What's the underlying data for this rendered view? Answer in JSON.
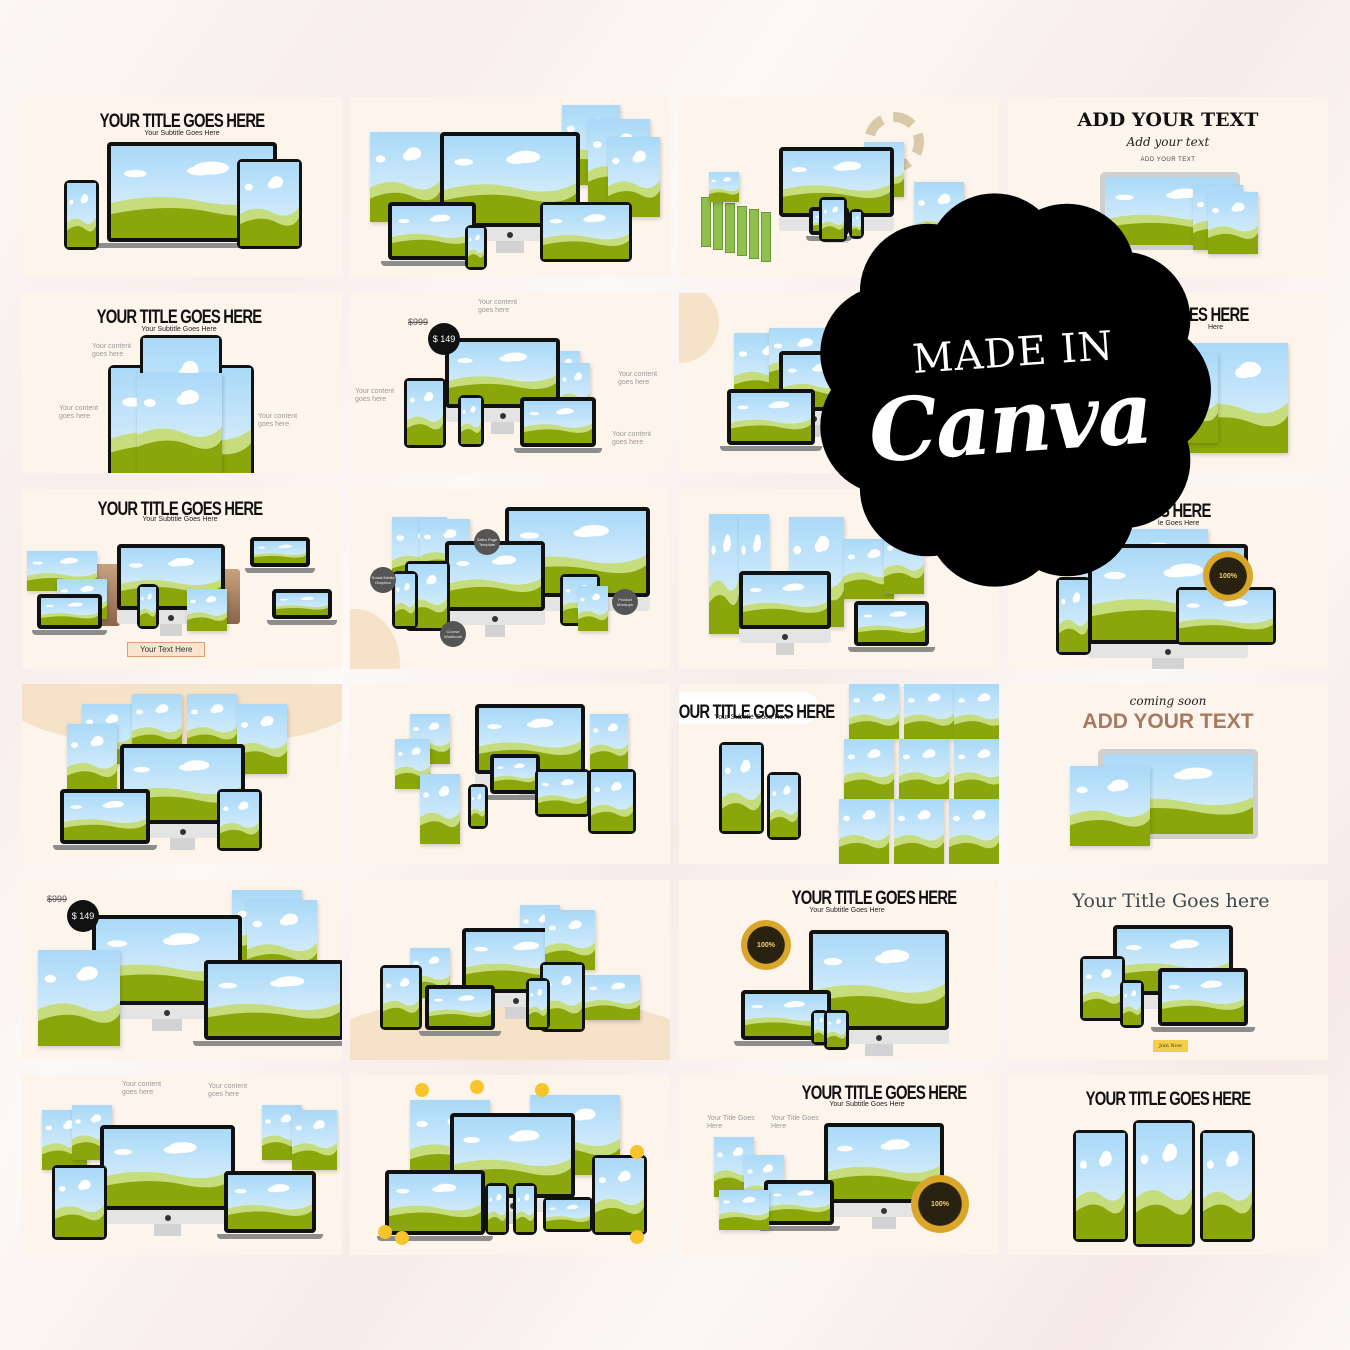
{
  "colors": {
    "tile_bg": "#fdf5ec",
    "sky": "#bfe3fa",
    "hill_light": "#c6dd7e",
    "hill_dark": "#8aa60a",
    "badge": "#000000",
    "brown_text": "#a67a62",
    "button_yellow": "#f4cf48"
  },
  "badge": {
    "line1": "MADE IN",
    "line2": "Canva"
  },
  "tiles": [
    {
      "title": "YOUR TITLE GOES HERE",
      "subtitle": "Your Subtitle Goes Here"
    },
    {},
    {},
    {
      "title": "ADD YOUR TEXT",
      "script": "Add your text",
      "small": "ADD YOUR TEXT"
    },
    {
      "title": "YOUR TITLE GOES HERE",
      "subtitle": "Your Subtitle Goes Here",
      "labels": [
        "Your content goes here",
        "Your content goes here",
        "Your content goes here"
      ]
    },
    {
      "old_price": "$999",
      "price": "$ 149",
      "labels": [
        "Your content goes here",
        "Your content goes here",
        "Your content goes here",
        "Your content goes here"
      ]
    },
    {},
    {
      "title": "GOES HERE",
      "subtitle": "Here"
    },
    {
      "title": "YOUR TITLE GOES HERE",
      "subtitle": "Your Subtitle Goes Here",
      "button": "Your Text Here"
    },
    {
      "bubbles": [
        "Sales Page Template",
        "Social Media Graphics",
        "Course Workbook",
        "Product Mockups"
      ]
    },
    {},
    {
      "title": "GOES HERE",
      "subtitle": "le Goes Here",
      "seal": "100%"
    },
    {},
    {},
    {
      "title": "YOUR TITLE GOES HERE",
      "subtitle": "Your Subtitle Goes Here"
    },
    {
      "script": "coming soon",
      "title": "ADD YOUR TEXT"
    },
    {
      "old_price": "$999",
      "price": "$ 149"
    },
    {},
    {
      "title": "YOUR TITLE GOES HERE",
      "subtitle": "Your Subtitle Goes Here",
      "seal": "100%"
    },
    {
      "title": "Your Title Goes here",
      "button": "Join Now"
    },
    {
      "labels": [
        "Your content goes here",
        "Your content goes here"
      ]
    },
    {},
    {
      "title": "YOUR TITLE GOES HERE",
      "subtitle": "Your Subtitle Goes Here",
      "labels": [
        "Your Title Goes Here",
        "Your Title Goes Here"
      ],
      "seal": "100%"
    },
    {
      "title": "YOUR TITLE GOES HERE"
    }
  ]
}
